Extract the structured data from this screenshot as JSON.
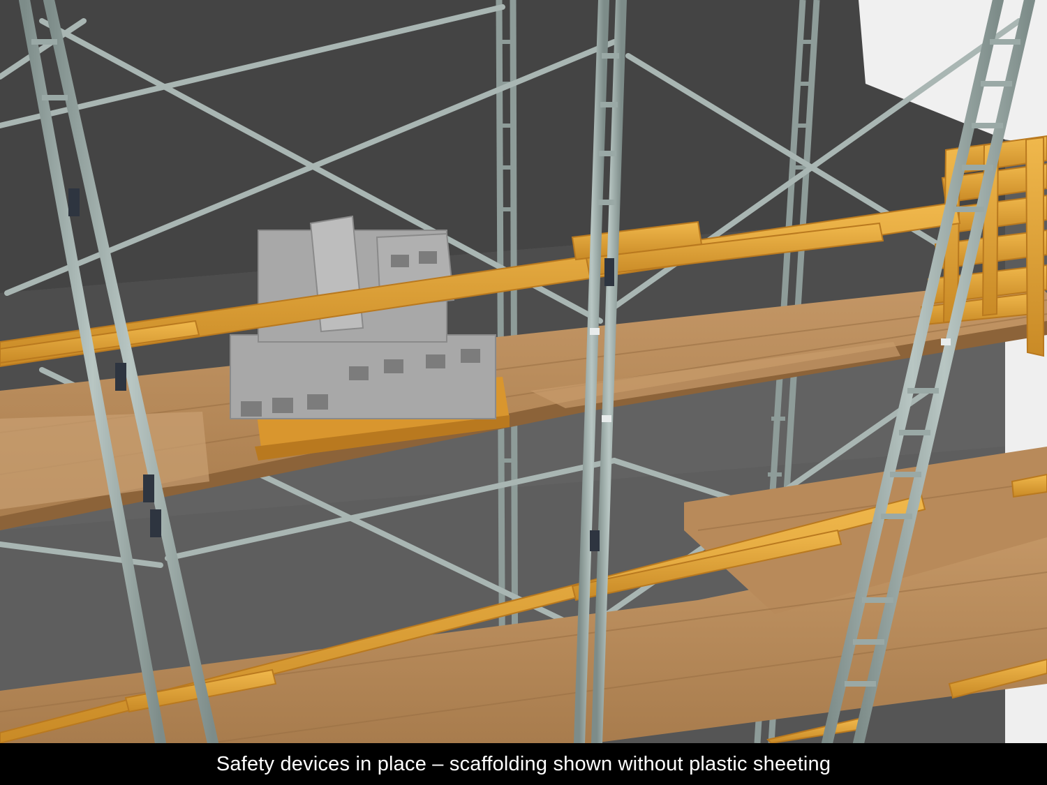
{
  "caption": "Safety devices in place – scaffolding shown without plastic sheeting",
  "colors": {
    "wall": "#5c5c5c",
    "wall_dark": "#404040",
    "white_wall": "#f2f2f2",
    "plank": "#b98b5a",
    "plank_edge": "#8c6339",
    "guard_rail": "#e3a63c",
    "guard_rail_edge": "#b9791f",
    "frame_pipe": "#9aa9a6",
    "frame_pipe_edge": "#6f7d7b",
    "pipe_band": "#2e3540",
    "block": "#a4a4a4",
    "caption_bg": "#000000",
    "caption_text": "#ffffff"
  }
}
